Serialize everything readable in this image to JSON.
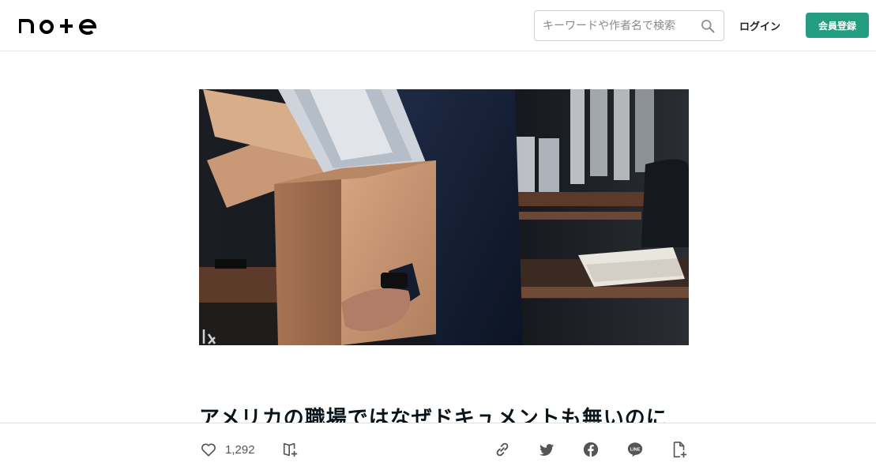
{
  "header": {
    "logo_text": "note",
    "search": {
      "placeholder": "キーワードや作者名で検索",
      "value": ""
    },
    "login_label": "ログイン",
    "signup_label": "会員登録",
    "accent_color": "#249c7f"
  },
  "article": {
    "hero_image": "photo of a businessman carrying a cardboard box of documents in an office",
    "title": "アメリカの職場ではなぜドキュメントも無いのに"
  },
  "actions": {
    "like_count": "1,292",
    "icons": [
      "heart-icon",
      "magazine-add-icon",
      "link-icon",
      "twitter-icon",
      "facebook-icon",
      "line-icon",
      "note-add-icon"
    ]
  }
}
